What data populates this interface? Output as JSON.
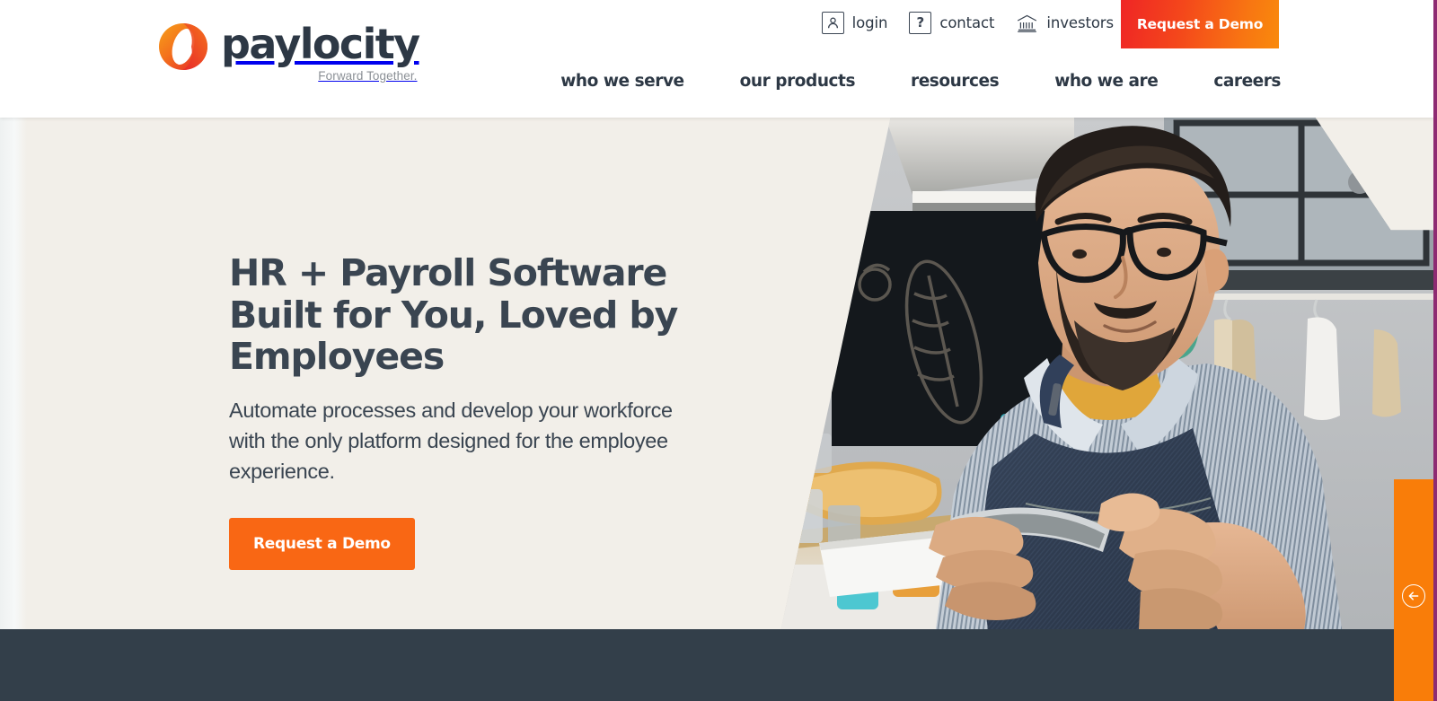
{
  "brand": {
    "wordmark": "paylocity",
    "tagline": "Forward Together.",
    "logo_colors": {
      "orange": "#F4731C",
      "red": "#E8262A",
      "navy": "#2D3845"
    }
  },
  "header": {
    "utility_nav": [
      {
        "icon": "user-icon",
        "label": "login"
      },
      {
        "icon": "question-mark-icon",
        "label": "contact"
      },
      {
        "icon": "bank-icon",
        "label": "investors"
      }
    ],
    "cta": {
      "label": "Request a Demo",
      "gradient_from": "#EF2525",
      "gradient_to": "#F98A0C"
    },
    "main_nav": [
      {
        "label": "who we serve"
      },
      {
        "label": "our products"
      },
      {
        "label": "resources"
      },
      {
        "label": "who we are"
      },
      {
        "label": "careers"
      }
    ]
  },
  "hero": {
    "background_color": "#F2EFE9",
    "title": "HR + Payroll Software Built for You, Loved by Employees",
    "subtitle": "Automate processes and develop your workforce with the only platform designed for the employee experience.",
    "cta": {
      "label": "Request a Demo",
      "color": "#F96714"
    },
    "image_alt": "Bearded man with glasses wearing a striped shirt and denim apron looking at a smartphone in a cafe"
  },
  "footer_band": {
    "color": "#333F4A"
  },
  "slideout": {
    "color": "#F97D09",
    "icon": "arrow-left-circle-icon"
  },
  "viewport": {
    "edge_border_color": "#8E2B72"
  }
}
